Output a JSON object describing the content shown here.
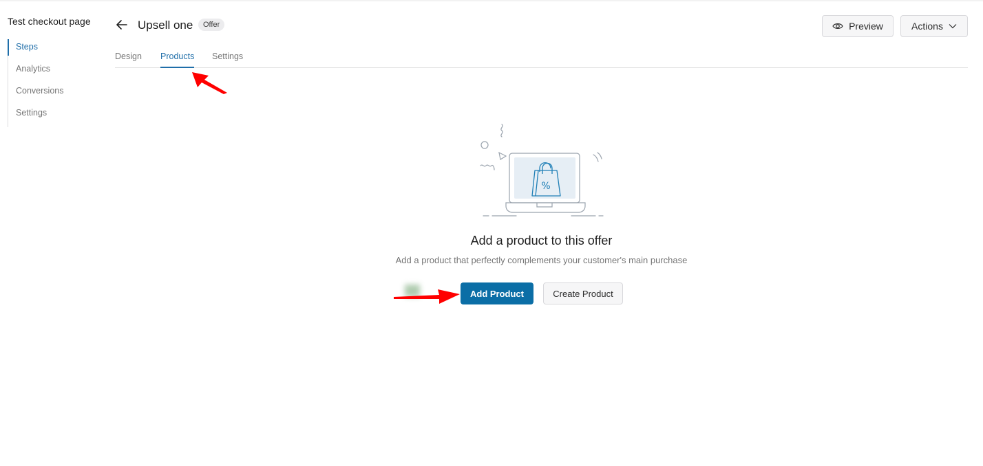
{
  "sidebar": {
    "title": "Test checkout page",
    "items": [
      {
        "label": "Steps",
        "active": true
      },
      {
        "label": "Analytics",
        "active": false
      },
      {
        "label": "Conversions",
        "active": false
      },
      {
        "label": "Settings",
        "active": false
      }
    ]
  },
  "header": {
    "back_icon": "arrow-left-icon",
    "title": "Upsell one",
    "badge": "Offer",
    "preview_label": "Preview",
    "preview_icon": "eye-icon",
    "actions_label": "Actions",
    "actions_icon": "chevron-down-icon"
  },
  "tabs": [
    {
      "label": "Design",
      "active": false
    },
    {
      "label": "Products",
      "active": true
    },
    {
      "label": "Settings",
      "active": false
    }
  ],
  "empty_state": {
    "illustration": "laptop-shopping-bag-discount-illustration",
    "title": "Add a product to this offer",
    "description": "Add a product that perfectly complements your customer's main purchase",
    "primary_button": "Add Product",
    "secondary_button": "Create Product"
  },
  "annotations": {
    "arrow_color": "#ff0000",
    "arrows": [
      "pointing-to-products-tab",
      "pointing-to-add-product-button"
    ]
  },
  "colors": {
    "accent": "#1f6ea9",
    "primary_button": "#0b6ea6"
  }
}
